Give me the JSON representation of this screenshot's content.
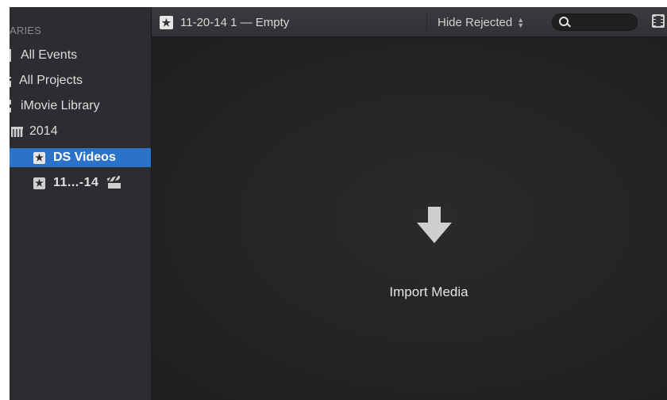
{
  "sidebar": {
    "header": "ARIES",
    "items": [
      {
        "label": "All Events"
      },
      {
        "label": "All Projects"
      },
      {
        "label": "iMovie Library"
      },
      {
        "label": "2014"
      },
      {
        "label": "DS Videos"
      },
      {
        "label": "11...-14"
      }
    ]
  },
  "toolbar": {
    "title": "11-20-14 1 — Empty",
    "filter": "Hide Rejected",
    "search_placeholder": ""
  },
  "main": {
    "import_label": "Import Media"
  },
  "colors": {
    "selection": "#2a73c8",
    "background": "#232323",
    "sidebar": "#2c2d30"
  }
}
